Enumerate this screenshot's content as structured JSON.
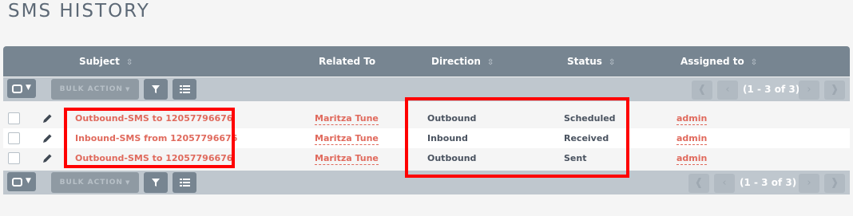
{
  "page": {
    "title": "SMS HISTORY"
  },
  "columns": [
    {
      "label": "Subject",
      "sortable": true
    },
    {
      "label": "Related To",
      "sortable": false
    },
    {
      "label": "Direction",
      "sortable": true
    },
    {
      "label": "Status",
      "sortable": true
    },
    {
      "label": "Assigned to",
      "sortable": true
    }
  ],
  "toolbar": {
    "bulk_action_label": "BULK ACTION",
    "pagination_text": "(1 - 3 of 3)"
  },
  "rows": [
    {
      "subject": "Outbound-SMS to 12057796676",
      "related_to": "Maritza Tune",
      "direction": "Outbound",
      "status": "Scheduled",
      "assigned_to": "admin"
    },
    {
      "subject": "Inbound-SMS from 12057796676",
      "related_to": "Maritza Tune",
      "direction": "Inbound",
      "status": "Received",
      "assigned_to": "admin"
    },
    {
      "subject": "Outbound-SMS to 12057796676",
      "related_to": "Maritza Tune",
      "direction": "Outbound",
      "status": "Sent",
      "assigned_to": "admin"
    }
  ],
  "colors": {
    "header_bg": "#778591",
    "toolbar_bg": "#bfc7ce",
    "link": "#e06a5d",
    "highlight": "#ff0000"
  }
}
